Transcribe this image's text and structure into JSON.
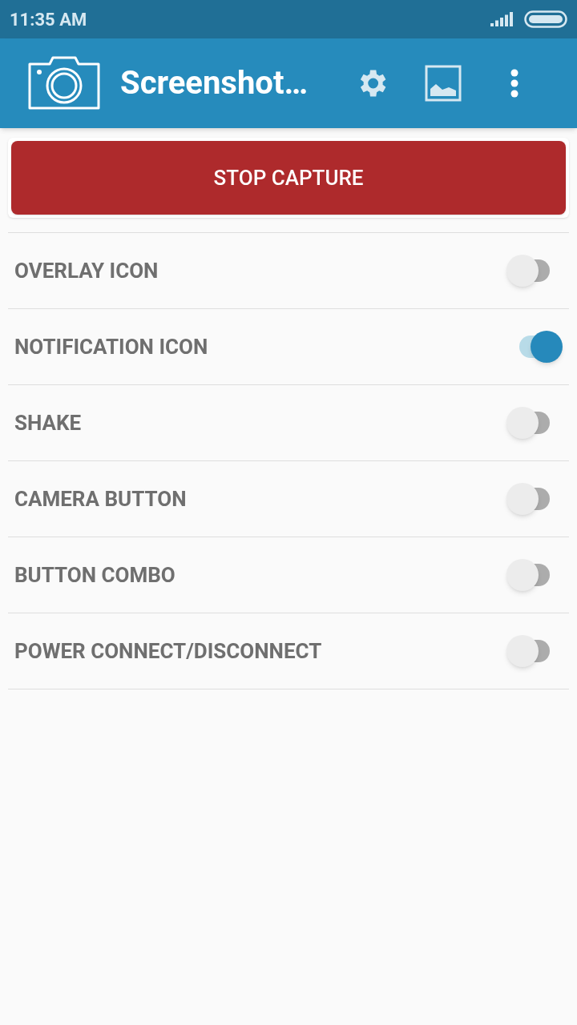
{
  "status_bar": {
    "time": "11:35 AM"
  },
  "app_bar": {
    "title": "Screenshot…"
  },
  "capture_button": {
    "label": "STOP CAPTURE"
  },
  "settings": [
    {
      "label": "OVERLAY ICON",
      "on": false
    },
    {
      "label": "NOTIFICATION ICON",
      "on": true
    },
    {
      "label": "SHAKE",
      "on": false
    },
    {
      "label": "CAMERA BUTTON",
      "on": false
    },
    {
      "label": "BUTTON COMBO",
      "on": false
    },
    {
      "label": "POWER CONNECT/DISCONNECT",
      "on": false
    }
  ]
}
